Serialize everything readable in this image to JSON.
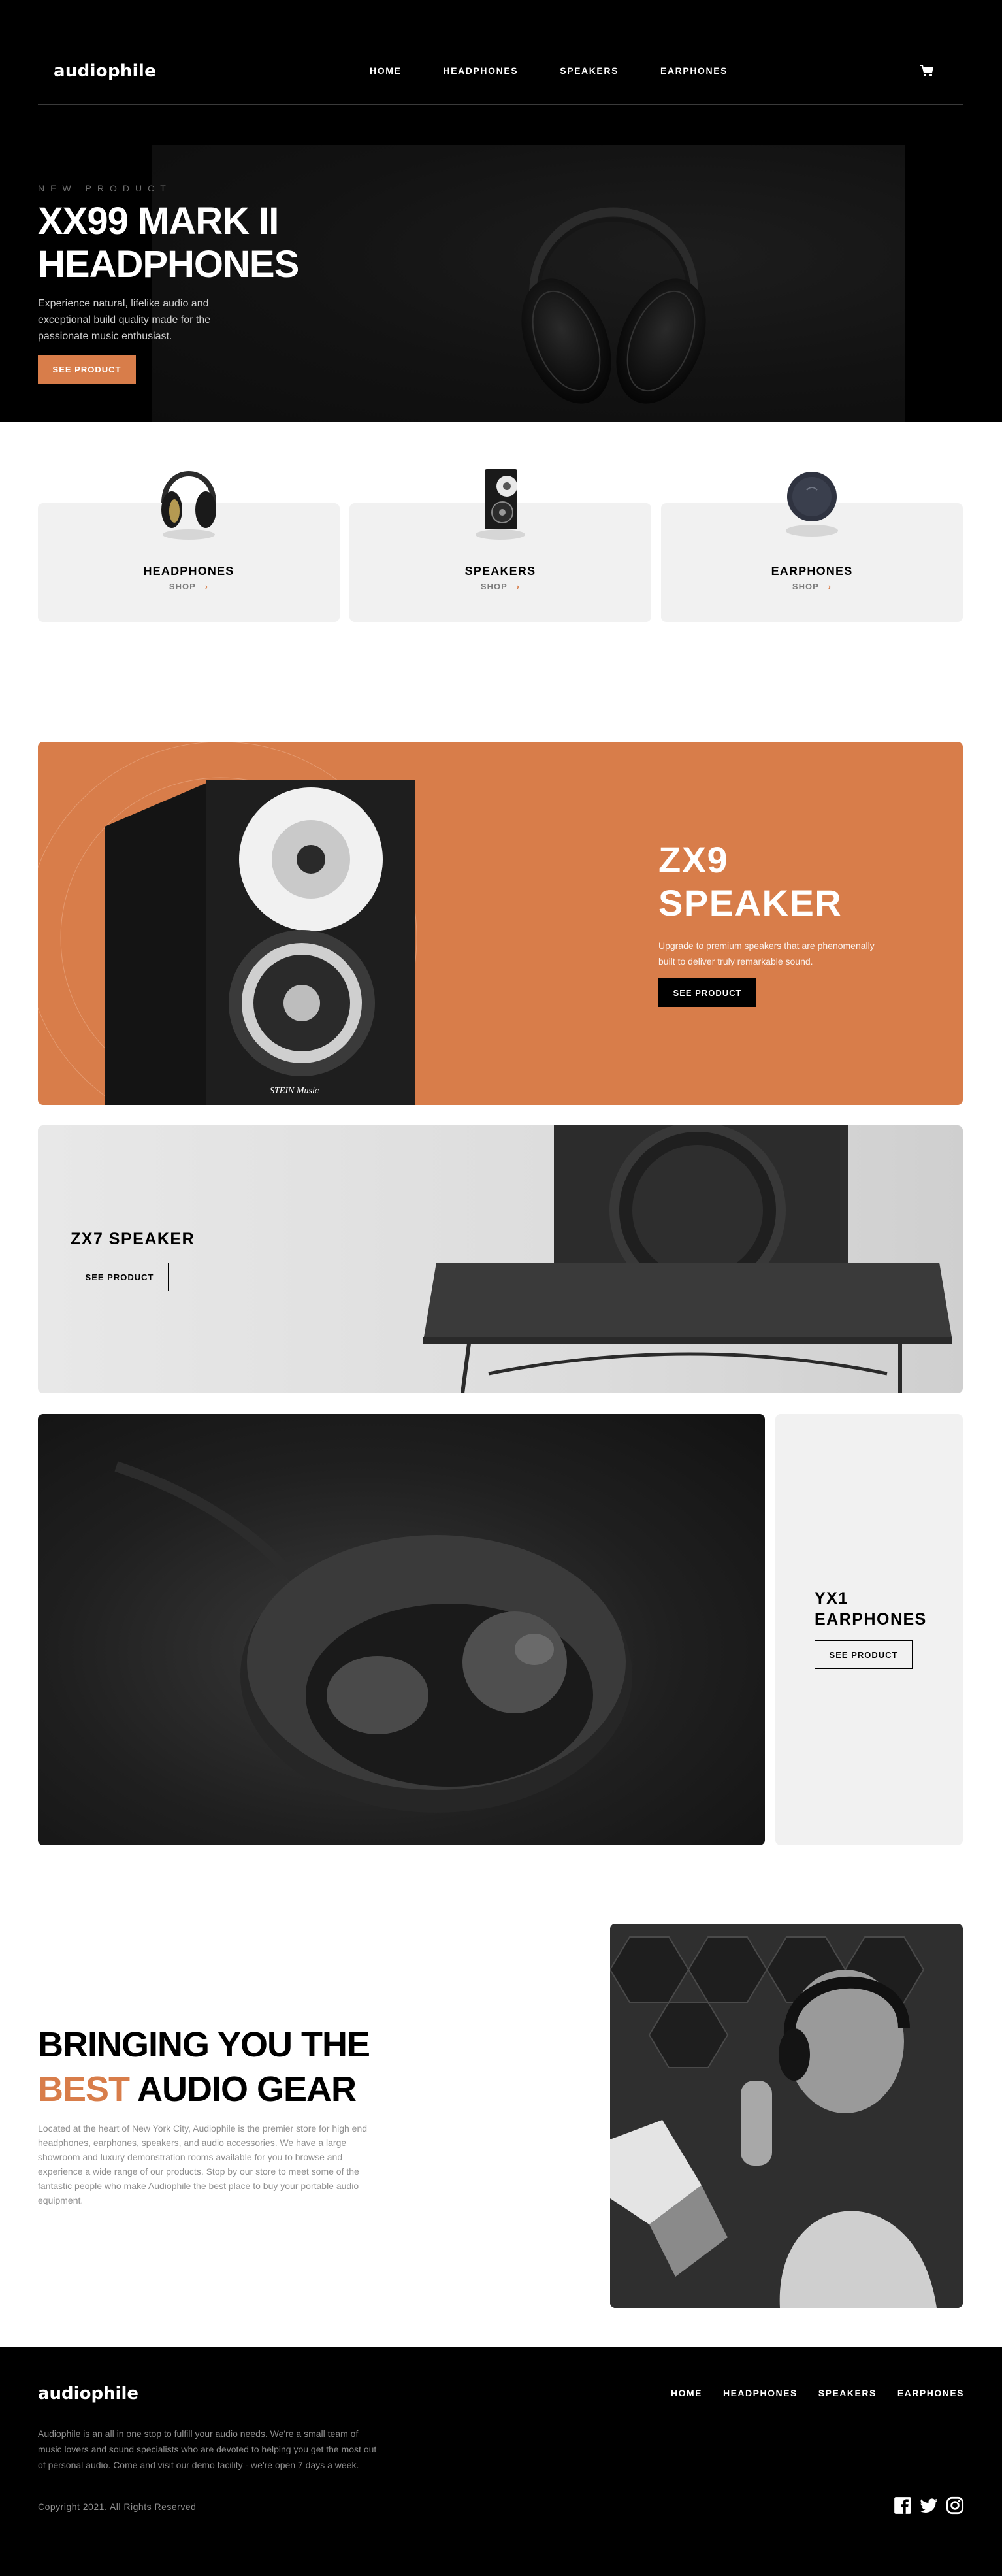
{
  "brand": {
    "logo": "audiophile",
    "accent": "#d87d4a"
  },
  "nav": {
    "items": [
      "HOME",
      "HEADPHONES",
      "SPEAKERS",
      "EARPHONES"
    ],
    "cart_icon": "cart-icon"
  },
  "hero": {
    "eyebrow": "NEW PRODUCT",
    "title_line1": "XX99 MARK II",
    "title_line2": "HEADPHONES",
    "description": "Experience natural, lifelike audio and exceptional build quality made for the passionate music enthusiast.",
    "button": "SEE PRODUCT"
  },
  "categories": [
    {
      "title": "HEADPHONES",
      "shop": "SHOP"
    },
    {
      "title": "SPEAKERS",
      "shop": "SHOP"
    },
    {
      "title": "EARPHONES",
      "shop": "SHOP"
    }
  ],
  "zx9": {
    "title_line1": "ZX9",
    "title_line2": "SPEAKER",
    "description": "Upgrade to premium speakers that are phenomenally built to deliver truly remarkable sound.",
    "button": "SEE PRODUCT",
    "speaker_brand": "STEIN Music"
  },
  "zx7": {
    "title": "ZX7 SPEAKER",
    "button": "SEE PRODUCT"
  },
  "yx1": {
    "title": "YX1 EARPHONES",
    "button": "SEE PRODUCT"
  },
  "about": {
    "title_line1": "BRINGING YOU THE",
    "title_accent": "BEST",
    "title_rest": "AUDIO GEAR",
    "description": "Located at the heart of New York City, Audiophile is the premier store for high end headphones, earphones, speakers, and audio accessories. We have a large showroom and luxury demonstration rooms available for you to browse and experience a wide range of our products. Stop by our store to meet some of the fantastic people who make Audiophile the best place to buy your portable audio equipment."
  },
  "footer": {
    "logo": "audiophile",
    "nav": [
      "HOME",
      "HEADPHONES",
      "SPEAKERS",
      "EARPHONES"
    ],
    "description": "Audiophile is an all in one stop to fulfill your audio needs. We're a small team of music lovers and sound specialists who are devoted to helping you get the most out of personal audio. Come and visit our demo facility - we're open 7 days a week.",
    "copyright": "Copyright 2021. All Rights Reserved",
    "social": [
      "facebook-icon",
      "twitter-icon",
      "instagram-icon"
    ]
  }
}
